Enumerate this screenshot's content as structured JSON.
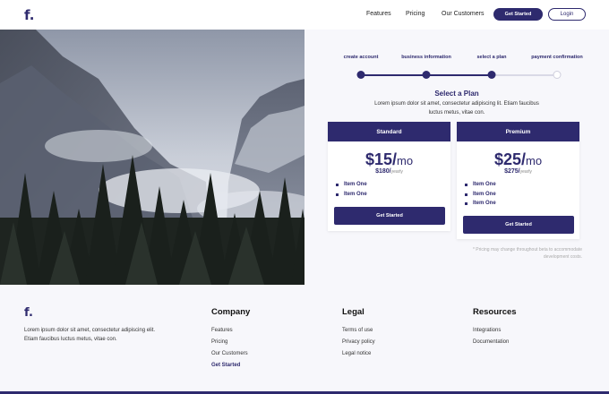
{
  "header": {
    "logo": "f.",
    "nav": [
      "Features",
      "Pricing",
      "Our Customers"
    ],
    "get_started": "Get Started",
    "login": "Login"
  },
  "steps": {
    "items": [
      "create account",
      "business information",
      "select a plan",
      "payment confirmation"
    ],
    "completed_count": 3
  },
  "plans_section": {
    "title": "Select a Plan",
    "description": "Lorem ipsum dolor sit amet, consectetur adipiscing lit. Etiam faucibus luctus metus, vitae con.",
    "plans": [
      {
        "name": "Standard",
        "price": "$15/",
        "period": "mo",
        "yearly_price": "$180/",
        "yearly_label": "yearly",
        "items": [
          "Item One",
          "Item One"
        ],
        "button": "Get Started"
      },
      {
        "name": "Premium",
        "price": "$25/",
        "period": "mo",
        "yearly_price": "$275/",
        "yearly_label": "yearly",
        "items": [
          "Item One",
          "Item One",
          "Item One"
        ],
        "button": "Get Started"
      }
    ],
    "note": "* Pricing may change throughout beta to accommodate development costs."
  },
  "footer": {
    "logo": "f.",
    "description": "Lorem ipsum dolor sit amet, consectetur adipiscing elit. Etiam faucibus luctus metus, vitae con.",
    "columns": [
      {
        "title": "Company",
        "links": [
          "Features",
          "Pricing",
          "Our Customers",
          "Get Started"
        ]
      },
      {
        "title": "Legal",
        "links": [
          "Terms of use",
          "Privacy policy",
          "Legal notice"
        ]
      },
      {
        "title": "Resources",
        "links": [
          "Integrations",
          "Documentation"
        ]
      }
    ]
  },
  "colors": {
    "primary": "#2e2a6e",
    "panel_bg": "#f7f7fb"
  }
}
